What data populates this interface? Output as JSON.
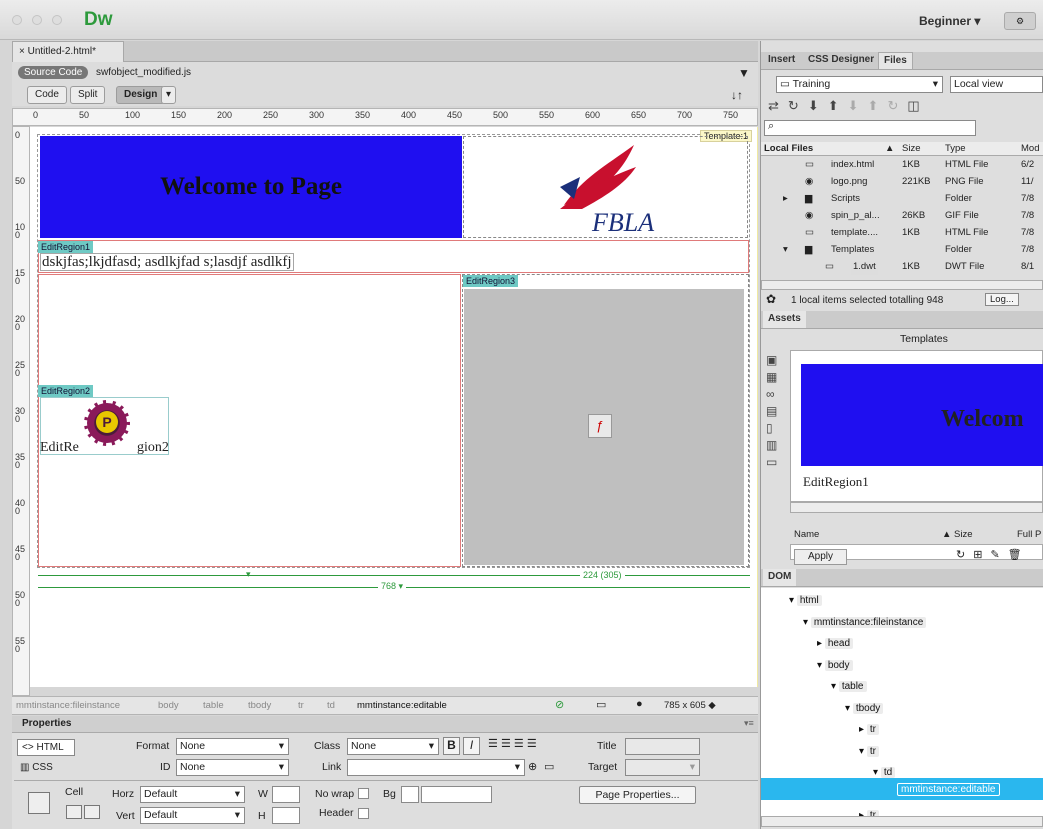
{
  "app": {
    "name": "Dw",
    "workspace": "Beginner"
  },
  "document": {
    "tab": "Untitled-2.html*",
    "source_code": "Source Code",
    "related_file": "swfobject_modified.js"
  },
  "views": {
    "code": "Code",
    "split": "Split",
    "design": "Design"
  },
  "ruler": {
    "ticks": [
      "0",
      "50",
      "100",
      "150",
      "200",
      "250",
      "300",
      "350",
      "400",
      "450",
      "500",
      "550",
      "600",
      "650",
      "700",
      "750"
    ],
    "vticks": [
      "0",
      "50",
      "100",
      "150",
      "200",
      "250",
      "300",
      "350",
      "400",
      "450",
      "500",
      "550"
    ]
  },
  "design": {
    "template_tag": "Template:1",
    "welcome": "Welcome to Page",
    "logo_text": "FBLA",
    "region1": {
      "tag": "EditRegion1",
      "text": "dskjfas;lkjdfasd; asdlkjfad s;lasdjf asdlkfj"
    },
    "region2": {
      "tag": "EditRegion2",
      "text_a": "EditRe",
      "text_b": "gion2"
    },
    "region3": {
      "tag": "EditRegion3"
    },
    "width_right": "224 (305)",
    "width_total": "768"
  },
  "tag_selector": {
    "items": [
      "mmtinstance:fileinstance",
      "body",
      "table",
      "tbody",
      "tr",
      "td"
    ],
    "active": "mmtinstance:editable",
    "size": "785 x 605"
  },
  "properties": {
    "title": "Properties",
    "html_btn": "HTML",
    "css_btn": "CSS",
    "format_label": "Format",
    "format_value": "None",
    "id_label": "ID",
    "id_value": "None",
    "class_label": "Class",
    "class_value": "None",
    "link_label": "Link",
    "title_label": "Title",
    "target_label": "Target",
    "cell_label": "Cell",
    "horz_label": "Horz",
    "horz_value": "Default",
    "vert_label": "Vert",
    "vert_value": "Default",
    "w_label": "W",
    "h_label": "H",
    "nowrap_label": "No wrap",
    "bg_label": "Bg",
    "header_label": "Header",
    "page_props": "Page Properties..."
  },
  "files_panel": {
    "tabs": [
      "Insert",
      "CSS Designer",
      "Files"
    ],
    "site": "Training",
    "view": "Local view",
    "columns": [
      "Local Files",
      "Size",
      "Type",
      "Mod"
    ],
    "rows": [
      {
        "name": "index.html",
        "size": "1KB",
        "type": "HTML File",
        "mod": "6/2"
      },
      {
        "name": "logo.png",
        "size": "221KB",
        "type": "PNG File",
        "mod": "11/"
      },
      {
        "name": "Scripts",
        "size": "",
        "type": "Folder",
        "mod": "7/8"
      },
      {
        "name": "spin_p_al...",
        "size": "26KB",
        "type": "GIF File",
        "mod": "7/8"
      },
      {
        "name": "template....",
        "size": "1KB",
        "type": "HTML File",
        "mod": "7/8"
      },
      {
        "name": "Templates",
        "size": "",
        "type": "Folder",
        "mod": "7/8"
      },
      {
        "name": "1.dwt",
        "size": "1KB",
        "type": "DWT File",
        "mod": "8/1"
      }
    ],
    "status": "1 local items selected totalling 948",
    "log_btn": "Log..."
  },
  "assets_panel": {
    "tab": "Assets",
    "heading": "Templates",
    "preview_text": "Welcom",
    "preview_region": "EditRegion1",
    "col_name": "Name",
    "col_size": "Size",
    "col_full": "Full P",
    "apply": "Apply"
  },
  "dom_panel": {
    "tab": "DOM",
    "nodes": [
      "html",
      "mmtinstance:fileinstance",
      "head",
      "body",
      "table",
      "tbody",
      "tr",
      "tr",
      "td",
      "mmtinstance:editable",
      "tr"
    ]
  }
}
